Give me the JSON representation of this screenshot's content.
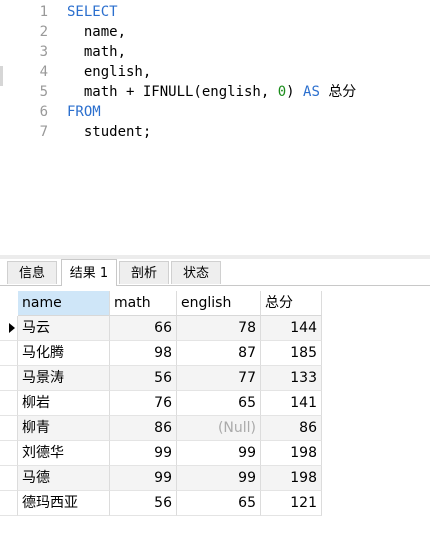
{
  "editor": {
    "lines": [
      {
        "num": "1",
        "parts": [
          {
            "t": "SELECT",
            "c": "kw"
          }
        ]
      },
      {
        "num": "2",
        "parts": [
          {
            "t": "  name,",
            "c": ""
          }
        ]
      },
      {
        "num": "3",
        "parts": [
          {
            "t": "  math,",
            "c": ""
          }
        ]
      },
      {
        "num": "4",
        "parts": [
          {
            "t": "  english,",
            "c": ""
          }
        ]
      },
      {
        "num": "5",
        "parts": [
          {
            "t": "  math + IFNULL(english, ",
            "c": ""
          },
          {
            "t": "0",
            "c": "num"
          },
          {
            "t": ") ",
            "c": ""
          },
          {
            "t": "AS",
            "c": "kw"
          },
          {
            "t": " ",
            "c": ""
          },
          {
            "t": "总分",
            "c": "cn"
          }
        ]
      },
      {
        "num": "6",
        "parts": [
          {
            "t": "FROM",
            "c": "kw"
          }
        ]
      },
      {
        "num": "7",
        "parts": [
          {
            "t": "  student;",
            "c": ""
          }
        ]
      }
    ]
  },
  "tabs": [
    {
      "label": "信息",
      "active": false
    },
    {
      "label": "结果 1",
      "active": true
    },
    {
      "label": "剖析",
      "active": false
    },
    {
      "label": "状态",
      "active": false
    }
  ],
  "grid": {
    "columns": [
      "name",
      "math",
      "english",
      "总分"
    ],
    "null_text": "(Null)",
    "rows": [
      [
        "马云",
        "66",
        "78",
        "144"
      ],
      [
        "马化腾",
        "98",
        "87",
        "185"
      ],
      [
        "马景涛",
        "56",
        "77",
        "133"
      ],
      [
        "柳岩",
        "76",
        "65",
        "141"
      ],
      [
        "柳青",
        "86",
        null,
        "86"
      ],
      [
        "刘德华",
        "99",
        "99",
        "198"
      ],
      [
        "马德",
        "99",
        "99",
        "198"
      ],
      [
        "德玛西亚",
        "56",
        "65",
        "121"
      ]
    ]
  },
  "colors": {
    "keyword": "#2b6fce",
    "number": "#1a8c1a",
    "header_selected": "#cfe6f8"
  }
}
